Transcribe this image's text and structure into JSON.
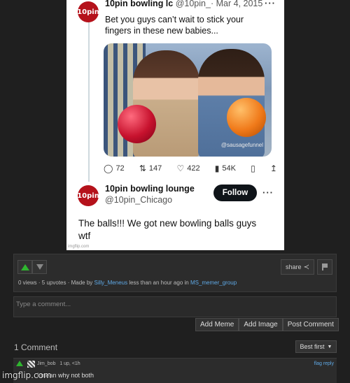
{
  "tweet1": {
    "avatar_text": "10pin",
    "name": "10pin bowling lc",
    "handle": "@10pin_·",
    "date": "Mar 4, 2015",
    "more": "···",
    "text_line1": "Bet you guys can’t wait to stick your",
    "text_line2": "fingers in these new babies...",
    "photo_watermark": "@sausagefunnel",
    "replies": "72",
    "retweets": "147",
    "likes": "422",
    "views": "54K"
  },
  "tweet2": {
    "avatar_text": "10pin",
    "name": "10pin bowling lounge",
    "handle": "@10pin_Chicago",
    "follow_label": "Follow",
    "more": "···",
    "text_line1": "The balls!!! We got new bowling balls guys",
    "text_line2": "wtf"
  },
  "meme_small_watermark": "imgflip.com",
  "info": {
    "views": "0 views",
    "sep1": " · ",
    "upvotes": "5 upvotes",
    "sep2": " · Made by ",
    "author": "Silly_Meneus",
    "time": " less than an hour ago in ",
    "stream": "MS_memer_group",
    "share_label": "share"
  },
  "comment_box": {
    "placeholder": "Type a comment...",
    "add_meme": "Add Meme",
    "add_image": "Add Image",
    "post_comment": "Post Comment"
  },
  "comments_header": {
    "count_label": "1 Comment",
    "sort_label": "Best first"
  },
  "comment1": {
    "username": "Jim_bob",
    "meta": "1 up, <1h",
    "flag": "flag",
    "reply": "reply",
    "text": "I mean why not both"
  },
  "site_watermark": "imgflip.com",
  "colors": {
    "background": "#1f1f1f",
    "link": "#5fa9e6",
    "upvote": "#2fb52f",
    "brand_avatar": "#b5121b"
  }
}
